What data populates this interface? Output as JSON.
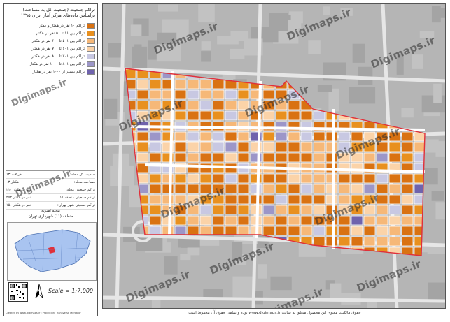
{
  "panel": {
    "title_line1": "تراکم جمعیت (جمعیت کل به مساحت)",
    "title_line2": "براساس داده‌های مرکز آمار ایران ۱۳۹۵"
  },
  "legend": [
    {
      "label": "تراکم ۱۰ نفر در هکتار و کمتر",
      "color": "#d97212"
    },
    {
      "label": "تراکم بین ۱۱ تا ۵۰ نفر در هکتار",
      "color": "#e8901f"
    },
    {
      "label": "تراکم بین ۵۰۱ تا ۶۰۰ نفر در هکتار",
      "color": "#f6b878"
    },
    {
      "label": "تراکم بین ۶۰۱ تا ۷۰۰ نفر در هکتار",
      "color": "#fbd3a8"
    },
    {
      "label": "تراکم بین ۷۰۱ تا ۸۰۰ نفر در هکتار",
      "color": "#c8c8e2"
    },
    {
      "label": "تراکم بین ۸۰۱ تا ۱۰۰۰ نفر در هکتار",
      "color": "#9c96c8"
    },
    {
      "label": "تراکم بیشتر از ۱۰۰۰ نفر در هکتار",
      "color": "#6f63ad"
    }
  ],
  "stats": [
    {
      "label": "جمعیت کل محله:",
      "value": "۱۳٬۰۰۷ نفر"
    },
    {
      "label": "مساحت محله:",
      "value": "۰۳ هکتار"
    },
    {
      "label": "تراکم جمعیتی محله:",
      "value": "۲۱۰ نفر در هکتار"
    },
    {
      "label": "تراکم جمعیتی منطقه ۱۱:",
      "value": "۲۵۲ نفر در هکتار"
    },
    {
      "label": "تراکم جمعیتی شهر تهران:",
      "value": "۱۵۰ نفر در هکتار"
    }
  ],
  "study": {
    "area_name": "محله امیریه",
    "district": "منطقه (۱۱) شهرداری تهران"
  },
  "scale": "Scale = 1:7,000",
  "north_label": "N",
  "footer_left": "Created by www.digimaps.ir | Projection: Transverse Mercator",
  "credit": "حقوق مالکیت معنوی این محصول متعلق به سایت www.digimaps.ir بوده و تمامی حقوق آن محفوظ است.",
  "watermark": "Digimaps.ir",
  "palette": {
    "dark_orange": "#d97212",
    "orange": "#e8901f",
    "light_orange": "#f6b878",
    "pale_orange": "#fbd3a8",
    "light_purple": "#c8c8e2",
    "purple": "#9c96c8",
    "dark_purple": "#6f63ad",
    "background": "#b5b5b5",
    "boundary": "#e0303a"
  }
}
